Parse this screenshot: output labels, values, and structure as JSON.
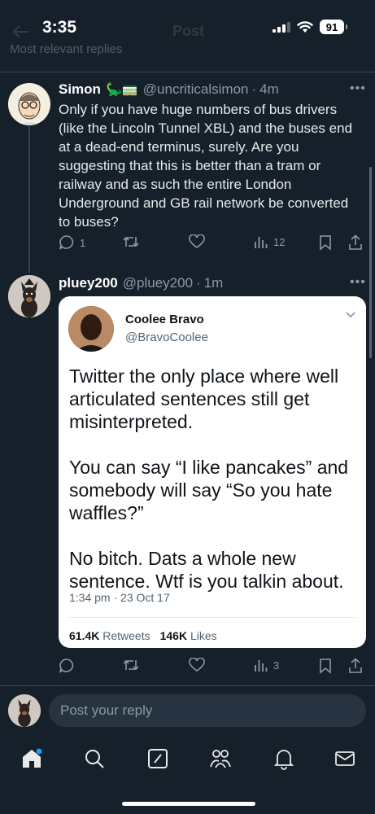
{
  "status": {
    "time": "3:35",
    "battery": "91"
  },
  "header": {
    "title": "Post",
    "sort_label": "Most relevant replies"
  },
  "reply1": {
    "name": "Simon",
    "emoji": "🦕🚃",
    "handle": "@uncriticalsimon",
    "time": "4m",
    "text": "Only if you have huge numbers of bus drivers (like the Lincoln Tunnel XBL) and the buses end at a dead-end terminus, surely. Are you suggesting that this is better than a tram or railway and as such the entire London Underground and GB rail network be converted to buses?",
    "replies": "1",
    "views": "12"
  },
  "reply2": {
    "name": "pluey200",
    "handle": "@pluey200",
    "time": "1m",
    "views": "3"
  },
  "quote": {
    "name": "Coolee Bravo",
    "handle": "@BravoCoolee",
    "para1": "Twitter the only place where well articulated sentences still get misinterpreted.",
    "para2": "You can say “I like pancakes” and somebody will say “So you hate waffles?”",
    "para3": "No bitch. Dats a whole new sentence. Wtf is you talkin about.",
    "timestamp": "1:34 pm · 23 Oct 17",
    "retweets_count": "61.4K",
    "retweets_label": "Retweets",
    "likes_count": "146K",
    "likes_label": "Likes"
  },
  "composer": {
    "placeholder": "Post your reply"
  },
  "tabbar": {
    "icons": [
      "home-icon",
      "search-icon",
      "compose-icon",
      "communities-icon",
      "notifications-icon",
      "messages-icon"
    ]
  },
  "colors": {
    "background": "#15202b",
    "accent": "#1d9bf0",
    "muted": "#8b98a5"
  }
}
